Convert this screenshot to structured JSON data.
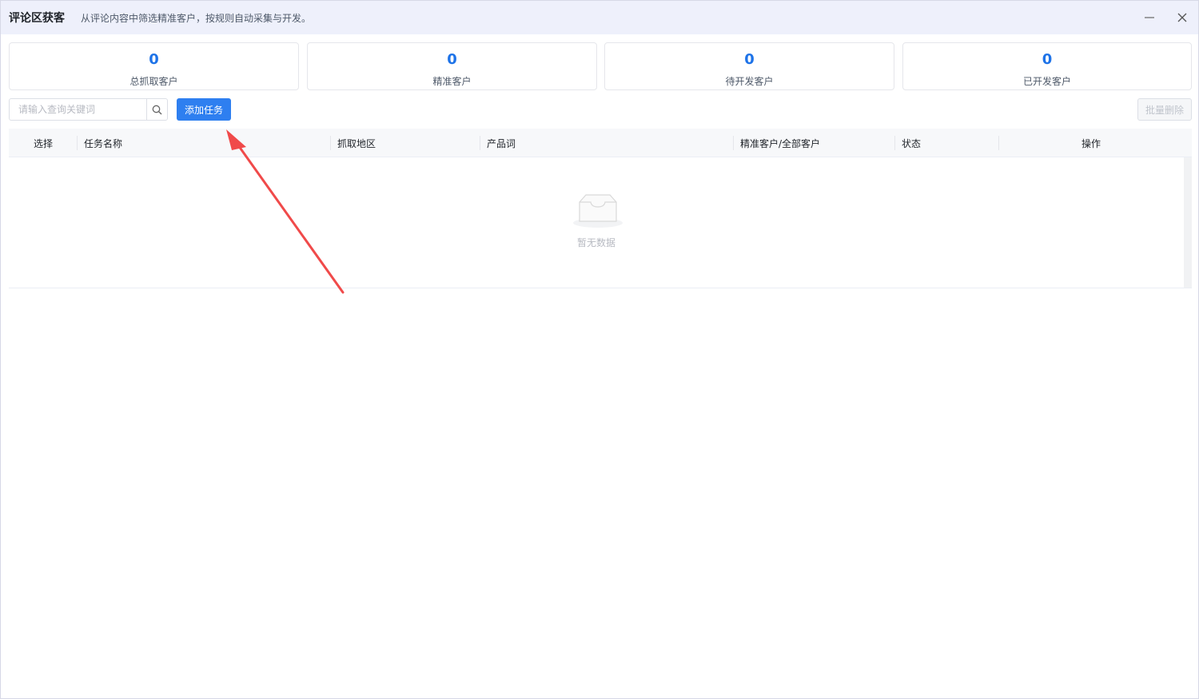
{
  "window": {
    "title": "评论区获客",
    "subtitle": "从评论内容中筛选精准客户，按规则自动采集与开发。",
    "controls": {
      "minimize_icon": "minimize-icon",
      "close_icon": "close-icon"
    }
  },
  "stats": [
    {
      "value": "0",
      "label": "总抓取客户"
    },
    {
      "value": "0",
      "label": "精准客户"
    },
    {
      "value": "0",
      "label": "待开发客户"
    },
    {
      "value": "0",
      "label": "已开发客户"
    }
  ],
  "toolbar": {
    "search_placeholder": "请输入查询关键词",
    "search_icon": "search-icon",
    "add_label": "添加任务",
    "batch_delete_label": "批量删除"
  },
  "table": {
    "columns": [
      "选择",
      "任务名称",
      "抓取地区",
      "产品词",
      "精准客户/全部客户",
      "状态",
      "操作"
    ],
    "rows": [],
    "empty_text": "暂无数据",
    "empty_icon": "empty-inbox-icon"
  },
  "annotation": {
    "color": "#f04a4a",
    "icon": "arrow-pointer-icon"
  },
  "colors": {
    "accent": "#2e7ff0",
    "stat_value": "#1e73e8",
    "titlebar": "#eef0fb"
  }
}
